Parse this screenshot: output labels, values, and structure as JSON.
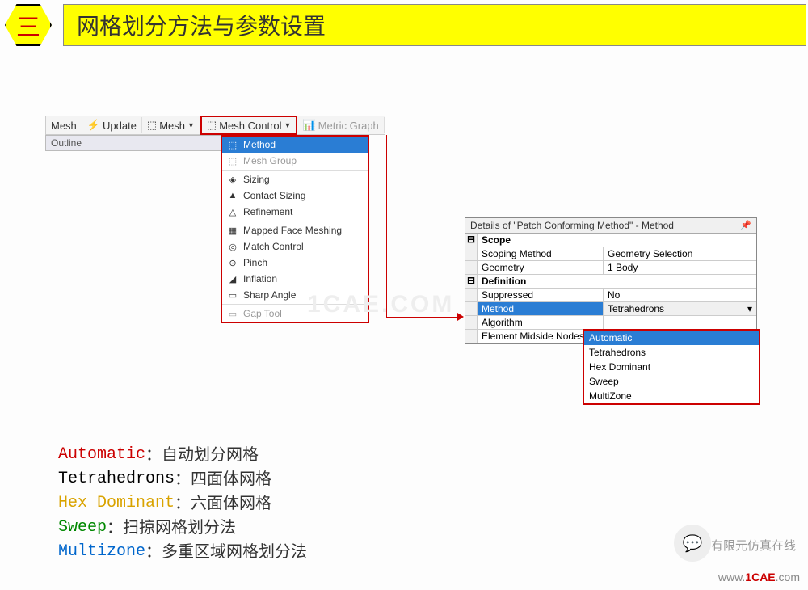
{
  "header": {
    "badge": "三",
    "title": "网格划分方法与参数设置"
  },
  "toolbar": {
    "mesh": "Mesh",
    "update": "Update",
    "mesh2": "Mesh",
    "meshControl": "Mesh Control",
    "metric": "Metric Graph"
  },
  "outline": {
    "label": "Outline"
  },
  "menu": [
    {
      "icon": "⬚",
      "label": "Method",
      "sel": true
    },
    {
      "icon": "⬚",
      "label": "Mesh Group",
      "gray": true
    },
    {
      "sep": true
    },
    {
      "icon": "◈",
      "label": "Sizing"
    },
    {
      "icon": "▲",
      "label": "Contact Sizing"
    },
    {
      "icon": "△",
      "label": "Refinement"
    },
    {
      "sep": true
    },
    {
      "icon": "▦",
      "label": "Mapped Face Meshing"
    },
    {
      "icon": "◎",
      "label": "Match Control"
    },
    {
      "icon": "⊙",
      "label": "Pinch"
    },
    {
      "icon": "◢",
      "label": "Inflation"
    },
    {
      "icon": "▭",
      "label": "Sharp Angle"
    },
    {
      "sep": true
    },
    {
      "icon": "▭",
      "label": "Gap Tool",
      "gray": true
    }
  ],
  "details": {
    "title": "Details of \"Patch Conforming Method\" - Method",
    "scope": "Scope",
    "scopingMethod": {
      "k": "Scoping Method",
      "v": "Geometry Selection"
    },
    "geometry": {
      "k": "Geometry",
      "v": "1 Body"
    },
    "definition": "Definition",
    "suppressed": {
      "k": "Suppressed",
      "v": "No"
    },
    "method": {
      "k": "Method",
      "v": "Tetrahedrons"
    },
    "algorithm": {
      "k": "Algorithm",
      "v": ""
    },
    "midside": {
      "k": "Element Midside Nodes",
      "v": ""
    }
  },
  "options": [
    "Automatic",
    "Tetrahedrons",
    "Hex Dominant",
    "Sweep",
    "MultiZone"
  ],
  "legend": [
    {
      "en": "Automatic",
      "color": "#c00",
      "cn": "：自动划分网格"
    },
    {
      "en": "Tetrahedrons",
      "color": "#000",
      "cn": "：四面体网格"
    },
    {
      "en": "Hex Dominant",
      "color": "#d9a300",
      "cn": "：六面体网格"
    },
    {
      "en": "Sweep",
      "color": "#008800",
      "cn": "：扫掠网格划分法"
    },
    {
      "en": "Multizone",
      "color": "#0066cc",
      "cn": "：多重区域网格划分法"
    }
  ],
  "watermark": {
    "center": "1CAE.COM",
    "brand": "有限元仿真在线",
    "url1": "www.",
    "url2": "1CAE",
    "url3": ".com"
  }
}
